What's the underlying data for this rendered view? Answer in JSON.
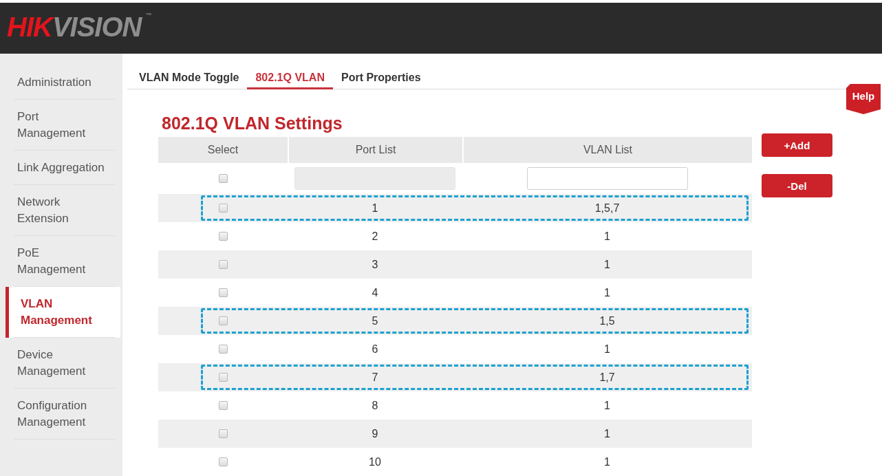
{
  "header": {
    "logo": {
      "parts": [
        {
          "text": "HIK",
          "color": "#e3141c"
        },
        {
          "text": "VISION",
          "color": "#8e8e8e"
        }
      ],
      "trademark": "™"
    }
  },
  "sidebar": {
    "items": [
      {
        "label": "Administration",
        "selected": false
      },
      {
        "label": "Port\nManagement",
        "selected": false
      },
      {
        "label": "Link Aggregation",
        "selected": false
      },
      {
        "label": "Network\nExtension",
        "selected": false
      },
      {
        "label": "PoE\nManagement",
        "selected": false
      },
      {
        "label": "VLAN\nManagement",
        "selected": true
      },
      {
        "label": "Device\nManagement",
        "selected": false
      },
      {
        "label": "Configuration\nManagement",
        "selected": false
      }
    ]
  },
  "tabs": [
    {
      "label": "VLAN Mode Toggle",
      "selected": false
    },
    {
      "label": "802.1Q VLAN",
      "selected": true
    },
    {
      "label": "Port Properties",
      "selected": false
    }
  ],
  "help_button": {
    "label": "Help"
  },
  "title": "802.1Q VLAN Settings",
  "table": {
    "columns": [
      "Select",
      "Port List",
      "VLAN List"
    ],
    "new_entry": {
      "checked": false,
      "port_field": {
        "disabled": true
      },
      "vlan_field": {
        "disabled": false
      }
    },
    "rows": [
      {
        "checked": false,
        "port": "1",
        "vlans": "1,5,7",
        "highlighted": true
      },
      {
        "checked": false,
        "port": "2",
        "vlans": "1",
        "highlighted": false
      },
      {
        "checked": false,
        "port": "3",
        "vlans": "1",
        "highlighted": false
      },
      {
        "checked": false,
        "port": "4",
        "vlans": "1",
        "highlighted": false
      },
      {
        "checked": false,
        "port": "5",
        "vlans": "1,5",
        "highlighted": true
      },
      {
        "checked": false,
        "port": "6",
        "vlans": "1",
        "highlighted": false
      },
      {
        "checked": false,
        "port": "7",
        "vlans": "1,7",
        "highlighted": true
      },
      {
        "checked": false,
        "port": "8",
        "vlans": "1",
        "highlighted": false
      },
      {
        "checked": false,
        "port": "9",
        "vlans": "1",
        "highlighted": false
      },
      {
        "checked": false,
        "port": "10",
        "vlans": "1",
        "highlighted": false
      }
    ]
  },
  "actions": [
    {
      "label": "+Add"
    },
    {
      "label": "-Del"
    }
  ]
}
